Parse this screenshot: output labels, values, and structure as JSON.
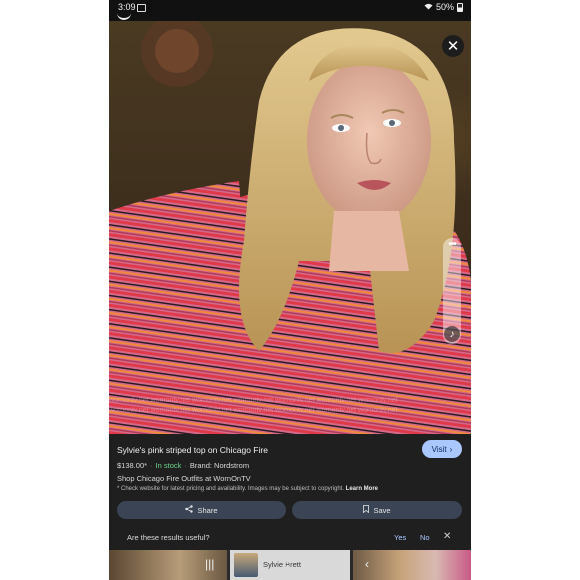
{
  "status_bar": {
    "time": "3:09",
    "battery": "50%"
  },
  "watermark_text": "wornontv.net  wornontv.net  wornontv.net  wornontv.net  wornontv.net  wornontv.net  wornontv.net",
  "product": {
    "title": "Sylvie's pink striped top on Chicago Fire",
    "price": "$138.00*",
    "stock": "In stock",
    "brand": "Brand: Nordstrom",
    "shop_line": "Shop Chicago Fire Outfits at WornOnTV",
    "disclaimer": "* Check website for latest pricing and availability. Images may be subject to copyright.",
    "learn_more": "Learn More"
  },
  "buttons": {
    "visit": "Visit",
    "share": "Share",
    "save": "Save"
  },
  "feedback": {
    "question": "Are these results useful?",
    "yes": "Yes",
    "no": "No"
  },
  "thumbnails": {
    "middle_label": "Sylvie Brett"
  },
  "icons": {
    "close": "close-icon",
    "more": "more-options-icon",
    "music": "music-note-icon",
    "share": "share-icon",
    "save": "bookmark-icon",
    "visit_chevron": "chevron-right-icon"
  },
  "colors": {
    "panel": "#1f1f1f",
    "visit_button": "#aac7ff",
    "action_button": "#3a4454",
    "in_stock": "#6dd58c",
    "link": "#aac7ff"
  }
}
